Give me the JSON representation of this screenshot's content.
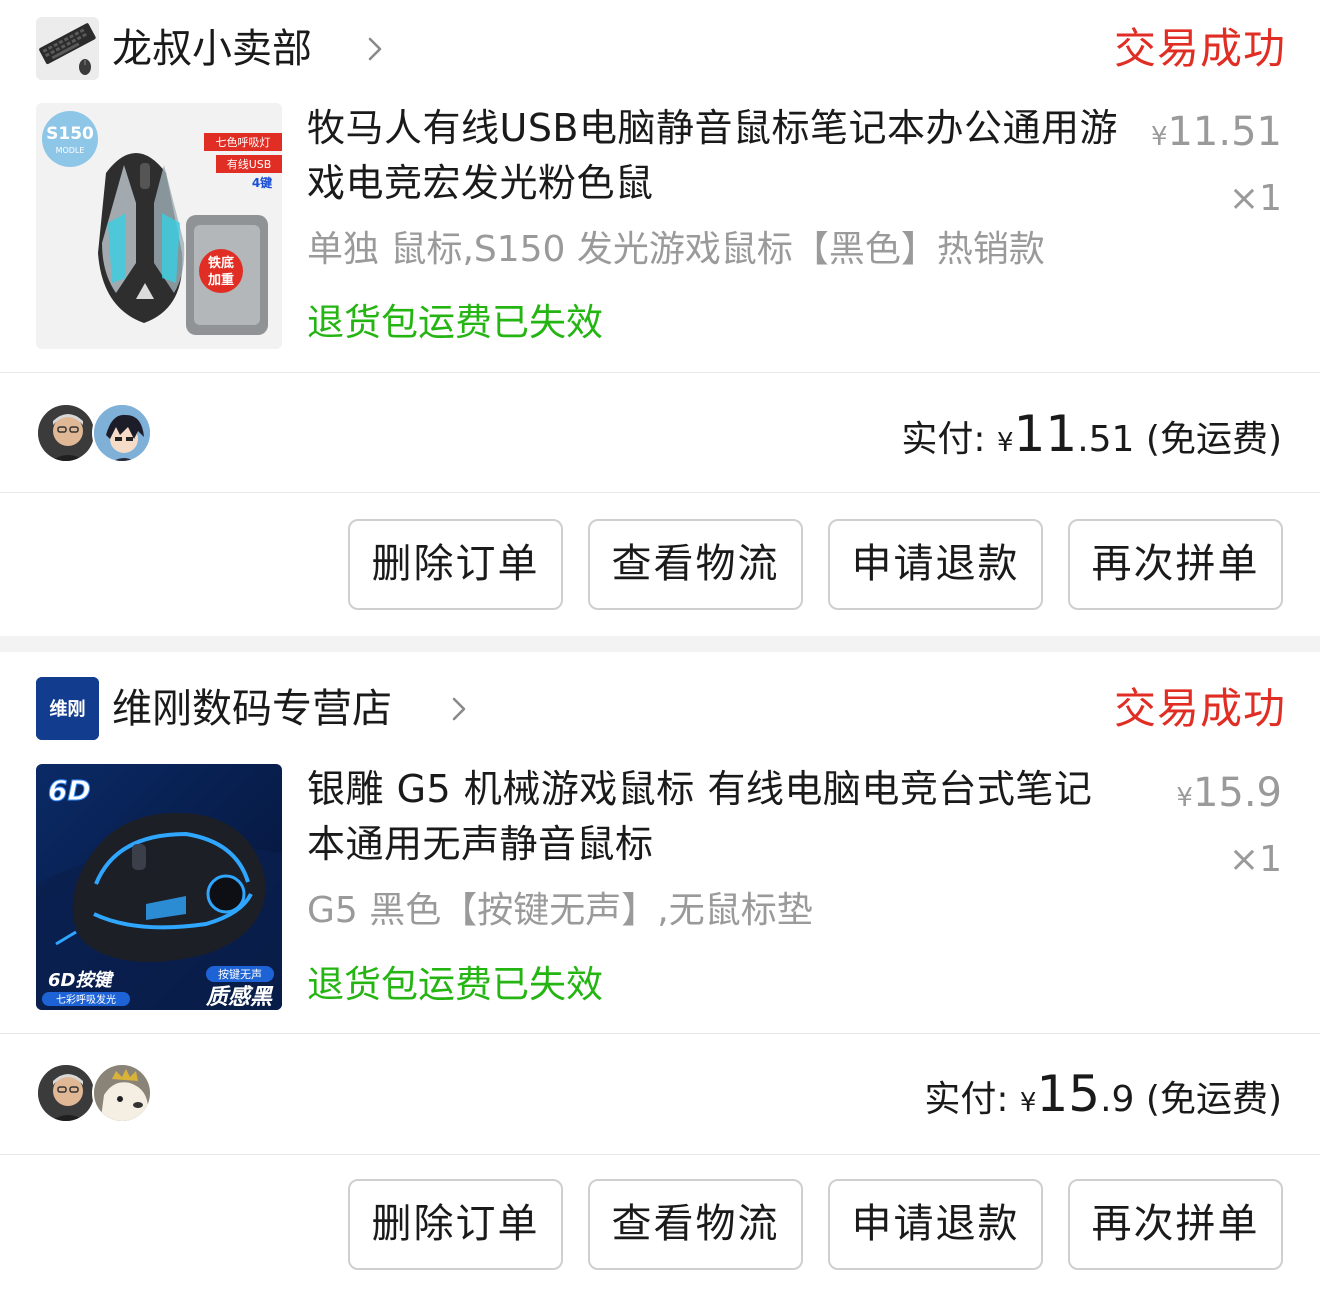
{
  "orders": [
    {
      "shop": {
        "name": "龙叔小卖部",
        "logo_icon": "keyboard-mouse-logo"
      },
      "status": "交易成功",
      "product": {
        "title": "牧马人有线USB电脑静音鼠标笔记本办公通用游戏电竞宏发光粉色鼠",
        "spec": "单独 鼠标,S150 发光游戏鼠标【黑色】热销款",
        "policy": "退货包运费已失效",
        "thumb": {
          "badge": "S150",
          "badge_sub": "MODLE",
          "tag1": "七色呼吸灯",
          "tag2": "有线USB",
          "tag3": "4键",
          "stamp1": "铁底",
          "stamp2": "加重"
        },
        "price_yen": "¥",
        "price": "11.51",
        "qty": "×1"
      },
      "payment": {
        "label": "实付:",
        "yen": "¥",
        "int": "11",
        "dec": ".51",
        "note": "(免运费)"
      },
      "actions": [
        "删除订单",
        "查看物流",
        "申请退款",
        "再次拼单"
      ]
    },
    {
      "shop": {
        "name": "维刚数码专营店",
        "logo_text": "维刚"
      },
      "status": "交易成功",
      "product": {
        "title": "银雕 G5 机械游戏鼠标 有线电脑电竞台式笔记本通用无声静音鼠标",
        "spec": "G5 黑色【按键无声】,无鼠标垫",
        "policy": "退货包运费已失效",
        "thumb": {
          "badge": "6D",
          "caption1": "6D按键",
          "caption1_sub": "七彩呼吸发光",
          "caption2_top": "按键无声",
          "caption2": "质感黑"
        },
        "price_yen": "¥",
        "price": "15.9",
        "qty": "×1"
      },
      "payment": {
        "label": "实付:",
        "yen": "¥",
        "int": "15",
        "dec": ".9",
        "note": "(免运费)"
      },
      "actions": [
        "删除订单",
        "查看物流",
        "申请退款",
        "再次拼单"
      ]
    }
  ],
  "colors": {
    "status_red": "#e02e24",
    "policy_green": "#25b513",
    "muted_gray": "#9a9a9a",
    "divider": "#e8e8e8",
    "section_gap": "#f3f3f3",
    "shop_logo_blue": "#123d8f"
  }
}
